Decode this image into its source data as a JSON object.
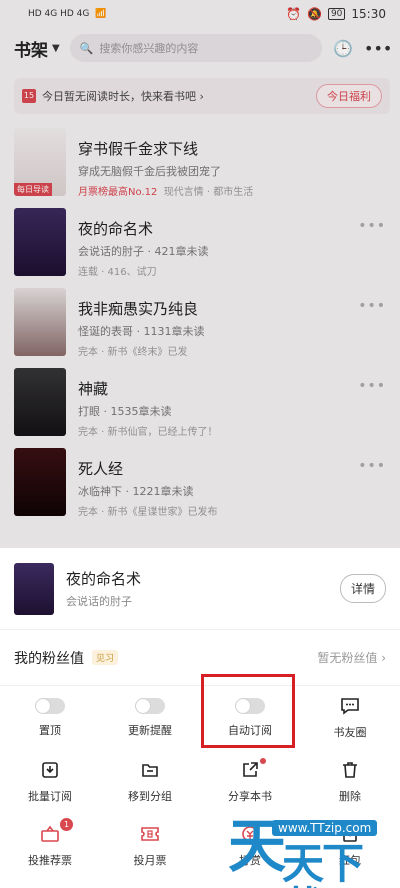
{
  "status_bar": {
    "left": "HD 4G HD 4G",
    "battery": "90",
    "time": "15:30"
  },
  "header": {
    "title": "书架",
    "search_placeholder": "搜索你感兴趣的内容"
  },
  "notice": {
    "calendar_day": "15",
    "text": "今日暂无阅读时长，快来看书吧 ›",
    "welfare_label": "今日福利"
  },
  "books": [
    {
      "title": "穿书假千金求下线",
      "author": "穿成无脑假千金后我被团宠了",
      "meta_hot": "月票榜最高No.12",
      "meta": "现代言情 · 都市生活",
      "cover_tag": "每日导读"
    },
    {
      "title": "夜的命名术",
      "author": "会说话的肘子 · 421章未读",
      "meta": "连载 · 416、试刀"
    },
    {
      "title": "我非痴愚实乃纯良",
      "author": "怪诞的表哥 · 1131章未读",
      "meta": "完本 · 新书《终末》已发"
    },
    {
      "title": "神藏",
      "author": "打眼 · 1535章未读",
      "meta": "完本 · 新书仙官，已经上传了！"
    },
    {
      "title": "死人经",
      "author": "冰临神下 · 1221章未读",
      "meta": "完本 · 新书《星谍世家》已发布"
    }
  ],
  "sheet": {
    "book_title": "夜的命名术",
    "book_author": "会说话的肘子",
    "detail_label": "详情",
    "fans_label": "我的粉丝值",
    "fans_badge": "见习",
    "fans_value": "暂无粉丝值 ›",
    "actions": [
      {
        "label": "置顶",
        "icon": "toggle-off"
      },
      {
        "label": "更新提醒",
        "icon": "toggle-off"
      },
      {
        "label": "自动订阅",
        "icon": "toggle-off"
      },
      {
        "label": "书友圈",
        "icon": "chat-bubble-icon"
      },
      {
        "label": "批量订阅",
        "icon": "download-icon"
      },
      {
        "label": "移到分组",
        "icon": "folder-icon"
      },
      {
        "label": "分享本书",
        "icon": "share-icon"
      },
      {
        "label": "删除",
        "icon": "trash-icon"
      },
      {
        "label": "投推荐票",
        "icon": "recommend-ticket-icon",
        "badge": "1"
      },
      {
        "label": "投月票",
        "icon": "monthly-ticket-icon"
      },
      {
        "label": "打赏",
        "icon": "reward-icon"
      },
      {
        "label": "红包",
        "icon": "red-packet-icon"
      }
    ]
  },
  "watermark": {
    "mark": "天",
    "text": "天下载",
    "url": "www.TTzip.com"
  },
  "colors": {
    "accent": "#d9474f",
    "highlight_box": "#d71f26",
    "watermark": "#1e88c8"
  }
}
